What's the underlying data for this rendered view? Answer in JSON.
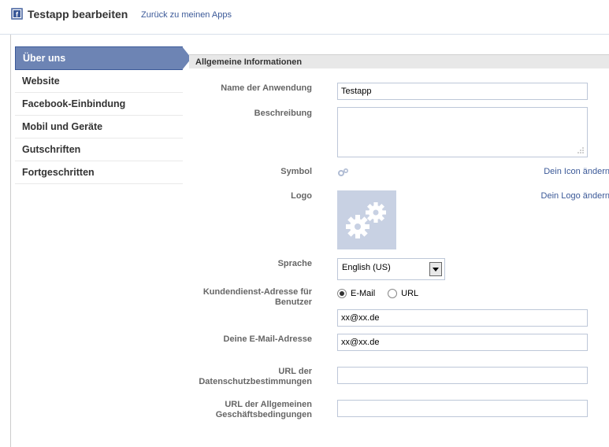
{
  "header": {
    "title": "Testapp bearbeiten",
    "back_link": "Zurück zu meinen Apps",
    "icon": "facebook-icon"
  },
  "sidebar": {
    "items": [
      {
        "label": "Über uns",
        "active": true
      },
      {
        "label": "Website",
        "active": false
      },
      {
        "label": "Facebook-Einbindung",
        "active": false
      },
      {
        "label": "Mobil und Geräte",
        "active": false
      },
      {
        "label": "Gutschriften",
        "active": false
      },
      {
        "label": "Fortgeschritten",
        "active": false
      }
    ]
  },
  "form": {
    "section_title": "Allgemeine Informationen",
    "app_name": {
      "label": "Name der Anwendung",
      "value": "Testapp"
    },
    "description": {
      "label": "Beschreibung",
      "value": ""
    },
    "symbol": {
      "label": "Symbol",
      "link": "Dein Icon ändern",
      "icon": "gears-icon"
    },
    "logo": {
      "label": "Logo",
      "link": "Dein Logo ändern",
      "icon": "gears-icon"
    },
    "language": {
      "label": "Sprache",
      "value": "English (US)"
    },
    "support": {
      "label": "Kundendienst-Adresse für Benutzer",
      "options": [
        {
          "label": "E-Mail",
          "checked": true
        },
        {
          "label": "URL",
          "checked": false
        }
      ],
      "value": "xx@xx.de"
    },
    "your_email": {
      "label": "Deine E-Mail-Adresse",
      "value": "xx@xx.de"
    },
    "privacy_url": {
      "label": "URL der Datenschutzbestimmungen",
      "value": ""
    },
    "terms_url": {
      "label": "URL der Allgemeinen Geschäftsbedingungen",
      "value": ""
    }
  },
  "colors": {
    "brand": "#3b5998",
    "active_nav": "#6d84b4",
    "logo_bg": "#c8d1e3"
  }
}
